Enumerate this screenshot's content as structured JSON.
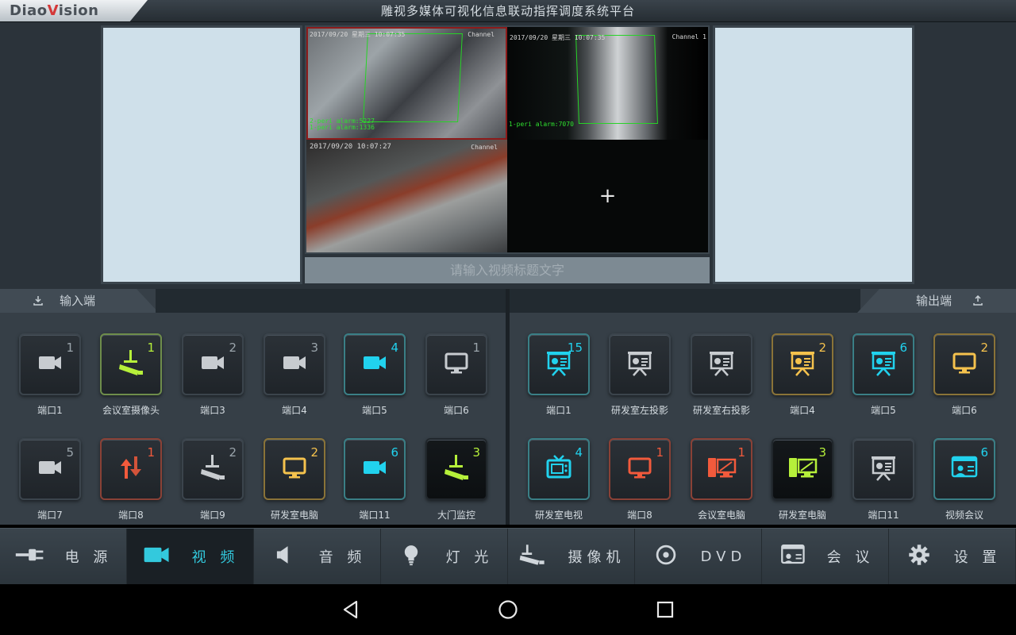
{
  "app": {
    "logo": "DiaoVision",
    "title": "雕视多媒体可视化信息联动指挥调度系统平台"
  },
  "display": {
    "caption_placeholder": "请输入视频标题文字",
    "add_symbol": "+",
    "cams": {
      "tl": {
        "osd_time": "2017/09/20 星期三 10:07:35",
        "osd_channel": "Channel",
        "alarm1": "2-peri alarm:5227",
        "alarm2": "1-peri alarm:1336"
      },
      "tr": {
        "osd_time": "2017/09/20 星期三 10:07:35",
        "osd_channel": "Channel 1",
        "alarm1": "1-peri alarm:7070"
      },
      "bl": {
        "osd_time": "2017/09/20 10:07:27",
        "osd_channel": "Channel"
      }
    }
  },
  "input_panel": {
    "title": "输入端",
    "tiles": [
      {
        "label": "端口1",
        "num": "1",
        "icon": "camera-icon",
        "style": "plain"
      },
      {
        "label": "会议室摄像头",
        "num": "1",
        "icon": "cctv-camera-icon",
        "style": "green"
      },
      {
        "label": "端口3",
        "num": "2",
        "icon": "camera-icon",
        "style": "plain"
      },
      {
        "label": "端口4",
        "num": "3",
        "icon": "camera-icon",
        "style": "plain"
      },
      {
        "label": "端口5",
        "num": "4",
        "icon": "camera-icon",
        "style": "cyan"
      },
      {
        "label": "端口6",
        "num": "1",
        "icon": "monitor-icon",
        "style": "plain"
      },
      {
        "label": "端口7",
        "num": "5",
        "icon": "camera-icon",
        "style": "plain"
      },
      {
        "label": "端口8",
        "num": "1",
        "icon": "swap-icon",
        "style": "red"
      },
      {
        "label": "端口9",
        "num": "2",
        "icon": "cctv-camera-icon",
        "style": "plain"
      },
      {
        "label": "研发室电脑",
        "num": "2",
        "icon": "monitor-icon",
        "style": "gold"
      },
      {
        "label": "端口11",
        "num": "6",
        "icon": "camera-icon",
        "style": "cyan"
      },
      {
        "label": "大门监控",
        "num": "3",
        "icon": "cctv-camera-icon",
        "style": "dark"
      }
    ]
  },
  "output_panel": {
    "title": "输出端",
    "tiles": [
      {
        "label": "端口1",
        "num": "15",
        "icon": "projector-screen-icon",
        "style": "cyan"
      },
      {
        "label": "研发室左投影",
        "num": "",
        "icon": "projector-screen-icon",
        "style": "plain"
      },
      {
        "label": "研发室右投影",
        "num": "",
        "icon": "projector-screen-icon",
        "style": "plain"
      },
      {
        "label": "端口4",
        "num": "2",
        "icon": "projector-screen-icon",
        "style": "gold"
      },
      {
        "label": "端口5",
        "num": "6",
        "icon": "projector-screen-icon",
        "style": "cyan"
      },
      {
        "label": "端口6",
        "num": "2",
        "icon": "monitor-icon",
        "style": "gold"
      },
      {
        "label": "研发室电视",
        "num": "4",
        "icon": "tv-icon",
        "style": "cyan"
      },
      {
        "label": "端口8",
        "num": "1",
        "icon": "monitor-icon",
        "style": "red"
      },
      {
        "label": "会议室电脑",
        "num": "1",
        "icon": "desktop-pc-icon",
        "style": "red"
      },
      {
        "label": "研发室电脑",
        "num": "3",
        "icon": "desktop-pc-icon",
        "style": "dark"
      },
      {
        "label": "端口11",
        "num": "",
        "icon": "projector-screen-icon",
        "style": "plain"
      },
      {
        "label": "视频会议",
        "num": "6",
        "icon": "video-conference-icon",
        "style": "cyan"
      }
    ]
  },
  "nav": {
    "items": [
      {
        "label": "电 源",
        "icon": "power-plug-icon"
      },
      {
        "label": "视 频",
        "icon": "video-camera-icon",
        "active": true
      },
      {
        "label": "音 频",
        "icon": "speaker-icon"
      },
      {
        "label": "灯 光",
        "icon": "light-bulb-icon"
      },
      {
        "label": "摄像机",
        "icon": "cctv-camera-icon"
      },
      {
        "label": "DVD",
        "icon": "disc-icon"
      },
      {
        "label": "会 议",
        "icon": "conference-icon"
      },
      {
        "label": "设 置",
        "icon": "gear-icon"
      }
    ]
  },
  "colors": {
    "green": "#b6f03a",
    "cyan": "#21d2ee",
    "gold": "#f5c24d",
    "red": "#f25a3c",
    "plain": "#c8ccd0",
    "active_nav": "#33c9dd"
  }
}
